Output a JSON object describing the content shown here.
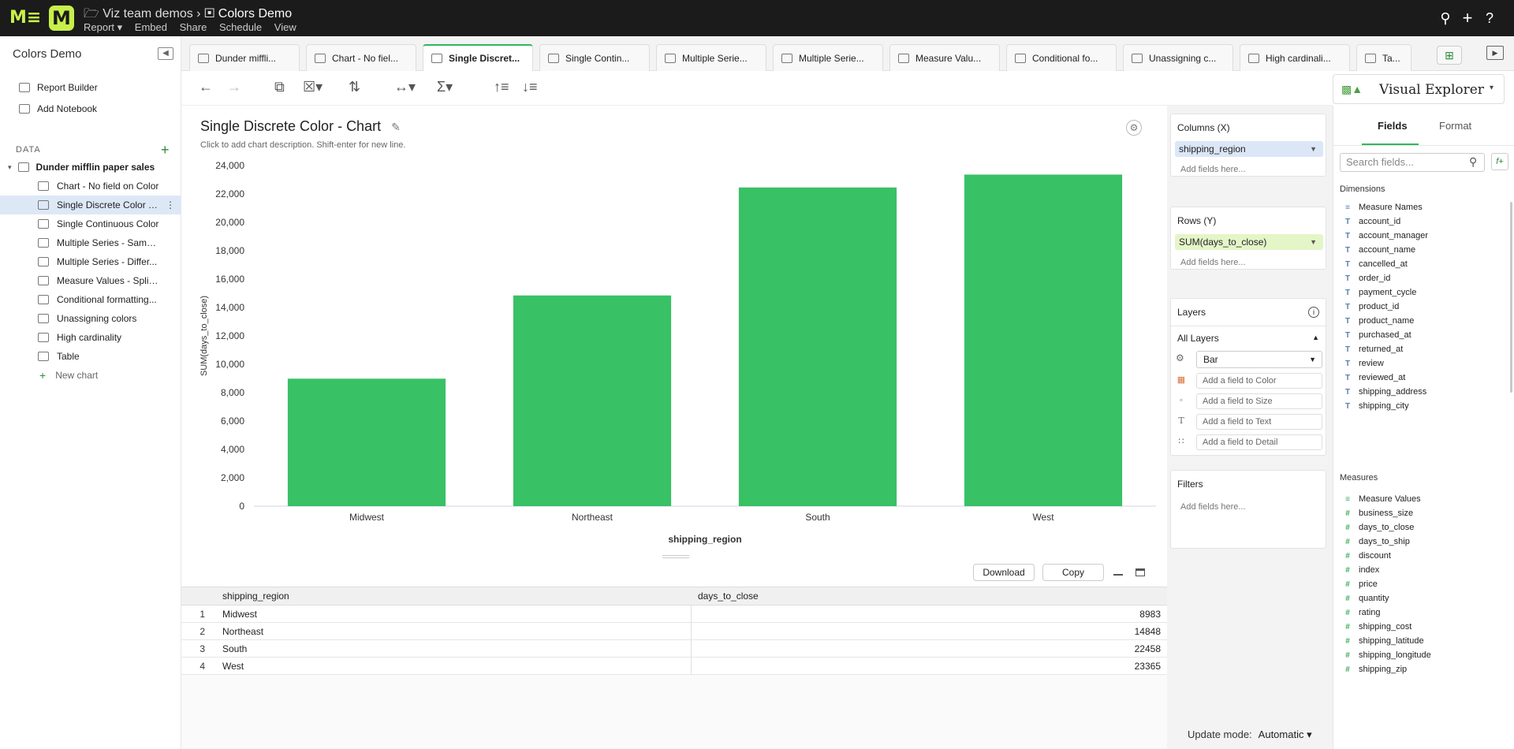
{
  "topbar": {
    "logo_text": "M≡",
    "app_badge": "M",
    "crumb_parent": "Viz team demos",
    "crumb_current": "Colors Demo",
    "menu": [
      "Report ▾",
      "Embed",
      "Share",
      "Schedule",
      "View"
    ]
  },
  "sidebar": {
    "title": "Colors Demo",
    "items": [
      "Report Builder",
      "Add Notebook"
    ],
    "data_header": "DATA",
    "source": "Dunder mifflin paper sales",
    "charts": [
      "Chart - No field on Color",
      "Single Discrete Color -...",
      "Single Continuous Color",
      "Multiple Series - Same ...",
      "Multiple Series - Differ...",
      "Measure Values - Split/...",
      "Conditional formatting...",
      "Unassigning colors",
      "High cardinality",
      "Table"
    ],
    "new_chart": "New chart"
  },
  "tabs": [
    "Dunder miffli...",
    "Chart - No fiel...",
    "Single Discret...",
    "Single Contin...",
    "Multiple Serie...",
    "Multiple Serie...",
    "Measure Valu...",
    "Conditional fo...",
    "Unassigning c...",
    "High cardinali...",
    "Ta..."
  ],
  "visual_explorer": "Visual Explorer",
  "chart_header": {
    "title": "Single Discrete Color - Chart",
    "description": "Click to add chart description. Shift-enter for new line."
  },
  "chart_data": {
    "type": "bar",
    "categories": [
      "Midwest",
      "Northeast",
      "South",
      "West"
    ],
    "values": [
      8983,
      14848,
      22458,
      23365
    ],
    "xlabel": "shipping_region",
    "ylabel": "SUM(days_to_close)",
    "ylim": [
      0,
      24000
    ],
    "yticks": [
      "0",
      "2,000",
      "4,000",
      "6,000",
      "8,000",
      "10,000",
      "12,000",
      "14,000",
      "16,000",
      "18,000",
      "20,000",
      "22,000",
      "24,000"
    ],
    "bar_color": "#38c165",
    "grid": false
  },
  "table": {
    "download": "Download",
    "copy": "Copy",
    "columns": [
      "shipping_region",
      "days_to_close"
    ],
    "rows": [
      {
        "n": "1",
        "region": "Midwest",
        "value": "8983"
      },
      {
        "n": "2",
        "region": "Northeast",
        "value": "14848"
      },
      {
        "n": "3",
        "region": "South",
        "value": "22458"
      },
      {
        "n": "4",
        "region": "West",
        "value": "23365"
      }
    ]
  },
  "shelves": {
    "columns_header": "Columns (X)",
    "columns_pill": "shipping_region",
    "rows_header": "Rows (Y)",
    "rows_pill": "SUM(days_to_close)",
    "add_fields": "Add fields here...",
    "layers_header": "Layers",
    "all_layers": "All Layers",
    "mark_type": "Bar",
    "marks": [
      "Add a field to Color",
      "Add a field to Size",
      "Add a field to Text",
      "Add a field to Detail"
    ],
    "filters_header": "Filters",
    "update_mode_label": "Update mode:",
    "update_mode_value": "Automatic ▾"
  },
  "fields_panel": {
    "tab_fields": "Fields",
    "tab_format": "Format",
    "search_placeholder": "Search fields...",
    "dimensions_header": "Dimensions",
    "dimensions": [
      "Measure Names",
      "account_id",
      "account_manager",
      "account_name",
      "cancelled_at",
      "order_id",
      "payment_cycle",
      "product_id",
      "product_name",
      "purchased_at",
      "returned_at",
      "review",
      "reviewed_at",
      "shipping_address",
      "shipping_city"
    ],
    "measures_header": "Measures",
    "measures": [
      "Measure Values",
      "business_size",
      "days_to_close",
      "days_to_ship",
      "discount",
      "index",
      "price",
      "quantity",
      "rating",
      "shipping_cost",
      "shipping_latitude",
      "shipping_longitude",
      "shipping_zip"
    ]
  }
}
